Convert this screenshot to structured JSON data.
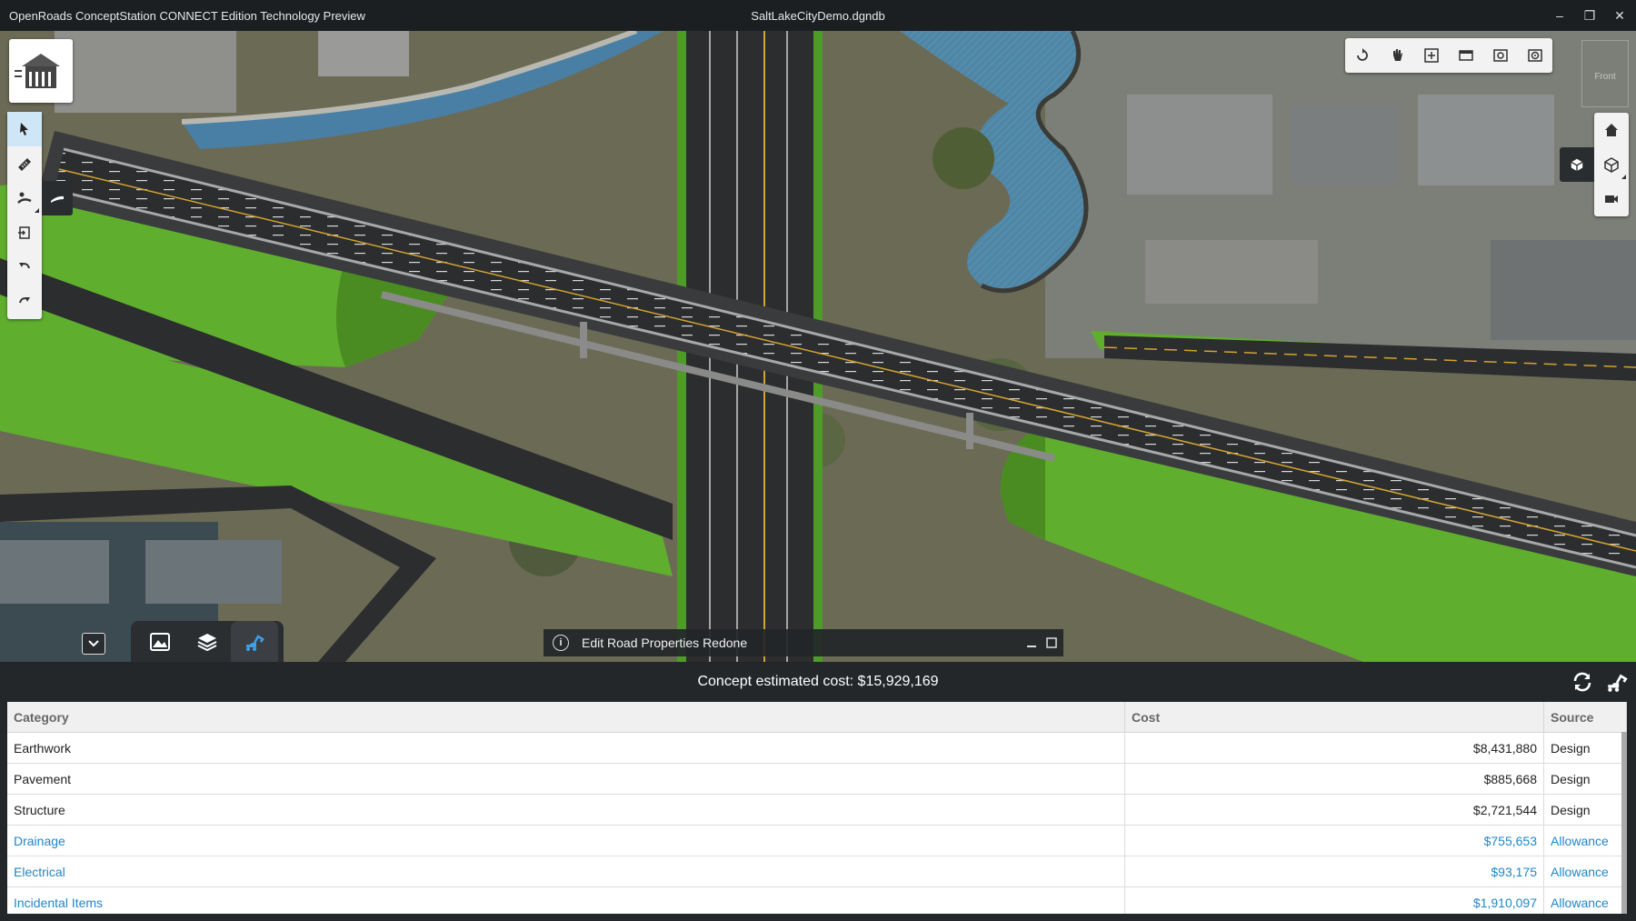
{
  "window": {
    "app_title": "OpenRoads ConceptStation CONNECT Edition Technology Preview",
    "document_title": "SaltLakeCityDemo.dgndb",
    "controls": {
      "minimize": "–",
      "restore": "❐",
      "close": "✕"
    }
  },
  "viewport": {
    "view_label": "Front",
    "left_toolbar": [
      {
        "name": "select-tool",
        "icon": "cursor-icon",
        "active": true
      },
      {
        "name": "measure-tool",
        "icon": "ruler-icon",
        "active": false
      },
      {
        "name": "sketch-tool",
        "icon": "road-sketch-icon",
        "active": false
      },
      {
        "name": "import-tool",
        "icon": "import-icon",
        "active": false
      },
      {
        "name": "undo-tool",
        "icon": "undo-icon",
        "active": false
      },
      {
        "name": "redo-tool",
        "icon": "redo-icon",
        "active": false
      }
    ],
    "top_toolbar": [
      "rotate-icon",
      "pan-hand-icon",
      "fit-view-icon",
      "window-area-icon",
      "camera-view-icon",
      "target-view-icon"
    ],
    "right_toolbar": [
      "home-icon",
      "view-cube-icon",
      "video-camera-icon"
    ],
    "notification": "Edit Road Properties Redone"
  },
  "bottom_tabs": [
    {
      "name": "tab-imagery",
      "icon": "landscape-icon",
      "active": false
    },
    {
      "name": "tab-layers",
      "icon": "layers-icon",
      "active": false
    },
    {
      "name": "tab-cost",
      "icon": "excavator-icon",
      "active": true
    }
  ],
  "cost_panel": {
    "total_label": "Concept estimated cost: $15,929,169",
    "columns": [
      "Category",
      "Cost",
      "Source"
    ],
    "rows": [
      {
        "category": "Earthwork",
        "cost": "$8,431,880",
        "source": "Design",
        "type": "design"
      },
      {
        "category": "Pavement",
        "cost": "$885,668",
        "source": "Design",
        "type": "design"
      },
      {
        "category": "Structure",
        "cost": "$2,721,544",
        "source": "Design",
        "type": "design"
      },
      {
        "category": "Drainage",
        "cost": "$755,653",
        "source": "Allowance",
        "type": "allowance"
      },
      {
        "category": "Electrical",
        "cost": "$93,175",
        "source": "Allowance",
        "type": "allowance"
      },
      {
        "category": "Incidental Items",
        "cost": "$1,910,097",
        "source": "Allowance",
        "type": "allowance"
      }
    ]
  },
  "colors": {
    "accent": "#1f86c9",
    "titlebar": "#1c1f22",
    "panel": "#24272a",
    "grass": "#5fae2e",
    "road": "#2c2d2f"
  }
}
